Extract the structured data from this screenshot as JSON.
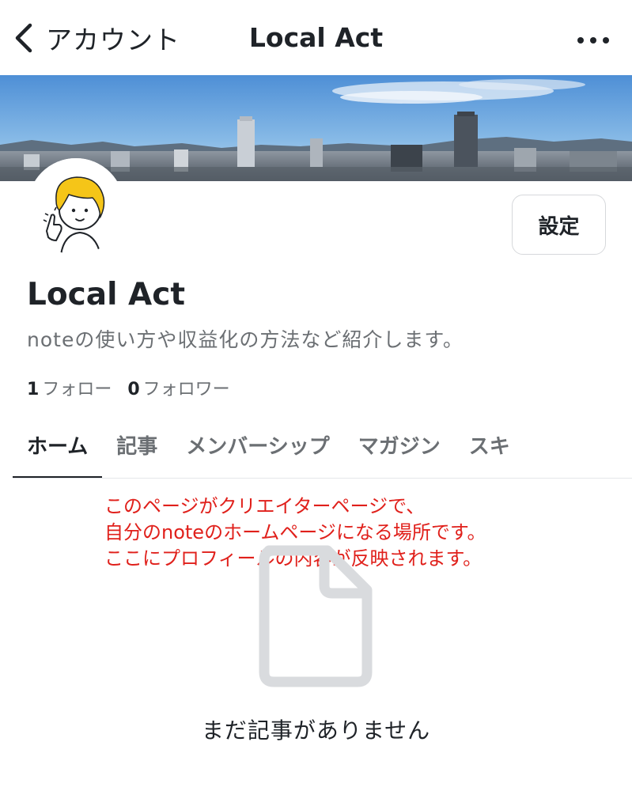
{
  "nav": {
    "back_label": "アカウント",
    "title": "Local Act",
    "back_icon": "chevron-left-icon",
    "more_icon": "ellipsis-icon"
  },
  "profile": {
    "name": "Local Act",
    "description": "noteの使い方や収益化の方法など紹介します。",
    "settings_label": "設定",
    "following_count": "1",
    "following_label": "フォロー",
    "followers_count": "0",
    "followers_label": "フォロワー"
  },
  "tabs": [
    {
      "label": "ホーム",
      "active": true
    },
    {
      "label": "記事",
      "active": false
    },
    {
      "label": "メンバーシップ",
      "active": false
    },
    {
      "label": "マガジン",
      "active": false
    },
    {
      "label": "スキ",
      "active": false
    }
  ],
  "annotation": {
    "lines": [
      "このページがクリエイターページで、",
      "自分のnoteのホームページになる場所です。",
      "ここにプロフィールの内容が反映されます。"
    ],
    "color": "#e0201b"
  },
  "empty_state": {
    "icon": "document-icon",
    "message": "まだ記事がありません"
  },
  "colors": {
    "text_primary": "#1f2328",
    "text_secondary": "#6b6f73",
    "annotation": "#e0201b"
  }
}
